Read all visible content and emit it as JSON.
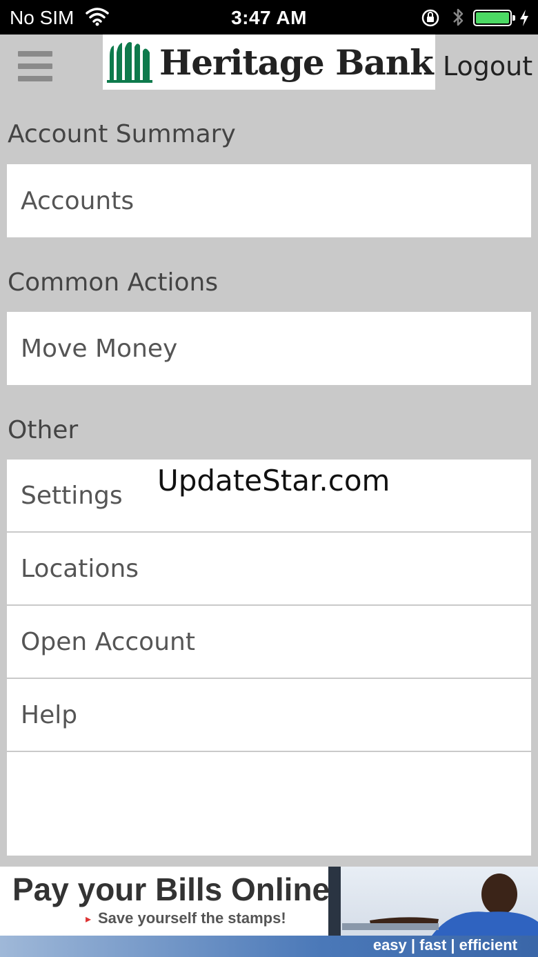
{
  "status_bar": {
    "carrier": "No SIM",
    "time": "3:47 AM",
    "battery_color": "#4cd964"
  },
  "header": {
    "logo_text": "Heritage Bank",
    "logout_label": "Logout",
    "menu_icon": "hamburger-icon"
  },
  "sections": {
    "account_summary": {
      "title": "Account Summary",
      "items": [
        "Accounts"
      ]
    },
    "common_actions": {
      "title": "Common Actions",
      "items": [
        "Move Money"
      ]
    },
    "other": {
      "title": "Other",
      "items": [
        "Settings",
        "Locations",
        "Open Account",
        "Help"
      ]
    }
  },
  "watermark": "UpdateStar.com",
  "banner": {
    "headline": "Pay your Bills Online",
    "subline": "Save yourself the stamps!",
    "tagline": "easy | fast | efficient"
  },
  "colors": {
    "background": "#c9c9c9",
    "logo_green": "#0e7a4c",
    "banner_blue": "#3a66a8"
  }
}
